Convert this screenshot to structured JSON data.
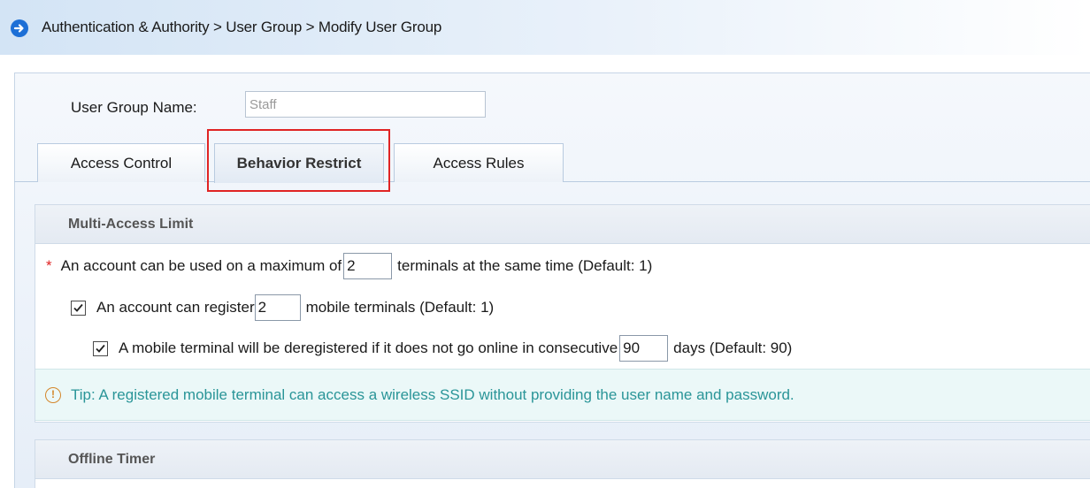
{
  "header": {
    "icon": "arrow-right-circle-icon",
    "breadcrumb": "Authentication & Authority > User Group > Modify User Group"
  },
  "form": {
    "name_label": "User Group Name:",
    "name_value": "Staff"
  },
  "tabs": [
    {
      "label": "Access Control",
      "active": false
    },
    {
      "label": "Behavior Restrict",
      "active": true
    },
    {
      "label": "Access Rules",
      "active": false
    }
  ],
  "multi_access": {
    "title": "Multi-Access Limit",
    "row1": {
      "required_mark": "*",
      "prefix": "An account can be used on a maximum of",
      "value": "2",
      "suffix": "terminals at the same time (Default: 1)"
    },
    "row2": {
      "checked": true,
      "prefix": "An account can register",
      "value": "2",
      "suffix": "mobile terminals (Default: 1)"
    },
    "row3": {
      "checked": true,
      "prefix": "A mobile terminal will be deregistered if it does not go online in consecutive",
      "value": "90",
      "suffix": "days (Default: 90)"
    }
  },
  "tip": {
    "icon": "info-icon",
    "text": "Tip: A registered mobile terminal can access a wireless SSID without providing the user name and password."
  },
  "offline_timer": {
    "title": "Offline Timer"
  },
  "colors": {
    "highlight": "#e02424",
    "tip_text": "#2a9598",
    "header_icon": "#1d6fd6"
  }
}
